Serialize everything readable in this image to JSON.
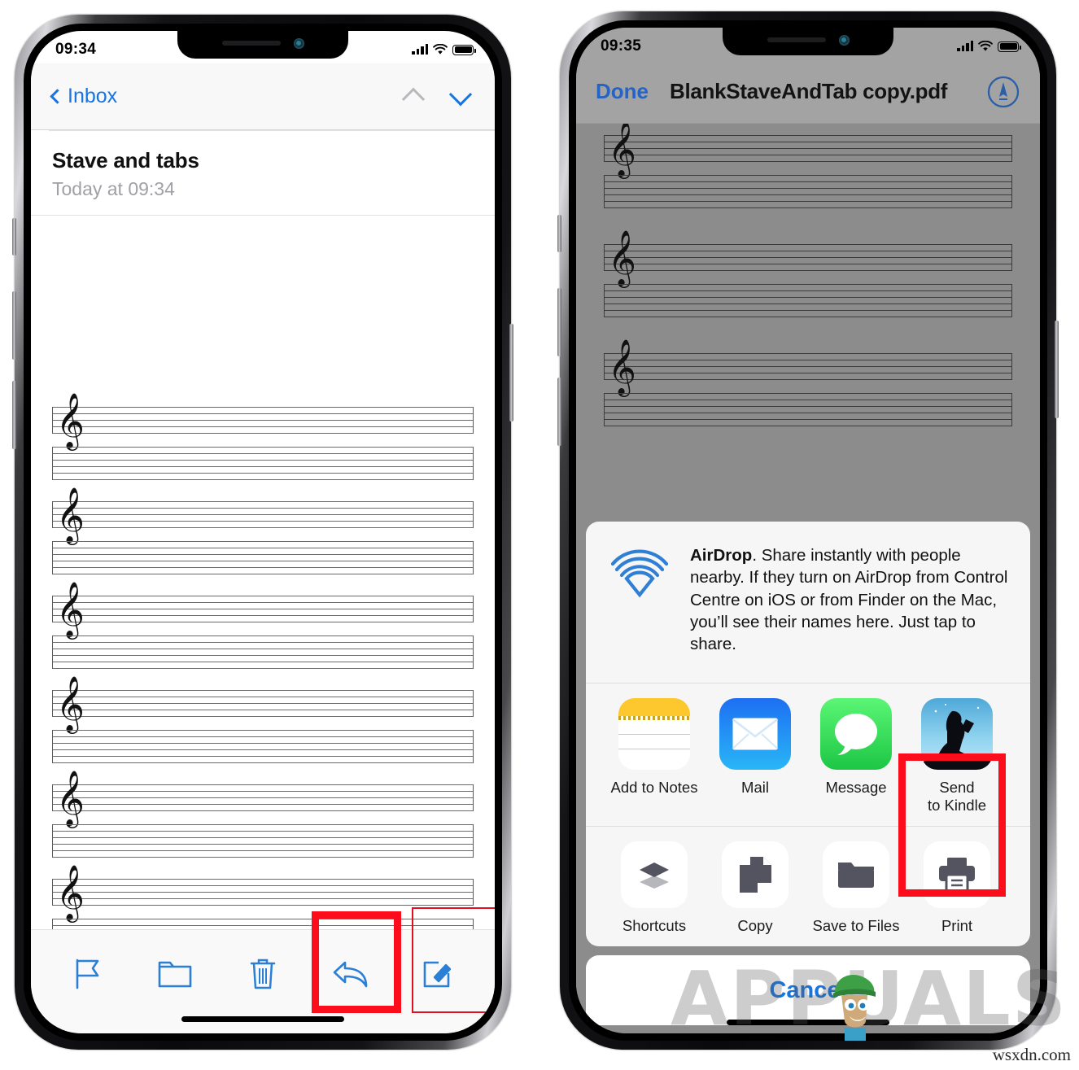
{
  "left_phone": {
    "status_bar": {
      "time": "09:34",
      "signal_icon": "cellular-bars-icon",
      "wifi_icon": "wifi-icon",
      "battery_icon": "battery-full-icon"
    },
    "nav": {
      "back_label": "Inbox",
      "back_icon": "chevron-left-icon",
      "prev_icon": "chevron-up-icon",
      "next_icon": "chevron-down-icon"
    },
    "message": {
      "subject": "Stave and tabs",
      "date": "Today at 09:34"
    },
    "toolbar": [
      {
        "name": "flag-icon",
        "label": "Flag",
        "highlighted": false
      },
      {
        "name": "folder-icon",
        "label": "Move to Folder",
        "highlighted": false
      },
      {
        "name": "trash-icon",
        "label": "Delete",
        "highlighted": false
      },
      {
        "name": "reply-icon",
        "label": "Reply",
        "highlighted": true
      },
      {
        "name": "compose-icon",
        "label": "Compose",
        "highlighted": true
      }
    ],
    "document": {
      "systems": 6,
      "stave_lines": 5,
      "tab_lines": 6,
      "clef": "treble-clef"
    }
  },
  "right_phone": {
    "status_bar": {
      "time": "09:35",
      "signal_icon": "cellular-bars-icon",
      "wifi_icon": "wifi-icon",
      "battery_icon": "battery-full-icon"
    },
    "nav": {
      "done_label": "Done",
      "title": "BlankStaveAndTab copy.pdf",
      "markup_icon": "markup-pen-icon"
    },
    "document": {
      "systems": 3,
      "stave_lines": 5,
      "tab_lines": 6,
      "clef": "treble-clef"
    },
    "share_sheet": {
      "airdrop": {
        "icon": "airdrop-icon",
        "title": "AirDrop",
        "description": ". Share instantly with people nearby. If they turn on AirDrop from Control Centre on iOS or from Finder on the Mac, you’ll see their names here. Just tap to share."
      },
      "apps": [
        {
          "label": "Add to Notes",
          "icon": "notes-app-icon"
        },
        {
          "label": "Mail",
          "icon": "mail-app-icon"
        },
        {
          "label": "Message",
          "icon": "messages-app-icon"
        },
        {
          "label": "Send\nto Kindle",
          "label_line1": "Send",
          "label_line2": "to Kindle",
          "icon": "kindle-app-icon"
        }
      ],
      "actions": [
        {
          "label": "Shortcuts",
          "icon": "shortcuts-icon",
          "highlighted": false
        },
        {
          "label": "Copy",
          "icon": "copy-icon",
          "highlighted": false
        },
        {
          "label": "Save to Files",
          "icon": "folder-icon",
          "highlighted": false
        },
        {
          "label": "Print",
          "icon": "printer-icon",
          "highlighted": true
        }
      ],
      "cancel_label": "Cancel"
    }
  },
  "watermarks": {
    "brand": "APPUALS",
    "site": "wsxdn.com"
  },
  "colors": {
    "ios_blue": "#1675e0",
    "highlight_red": "#fc0d1b",
    "pdf_dim_gray": "#8c8c8c",
    "sheet_bg": "#f6f6f6"
  }
}
